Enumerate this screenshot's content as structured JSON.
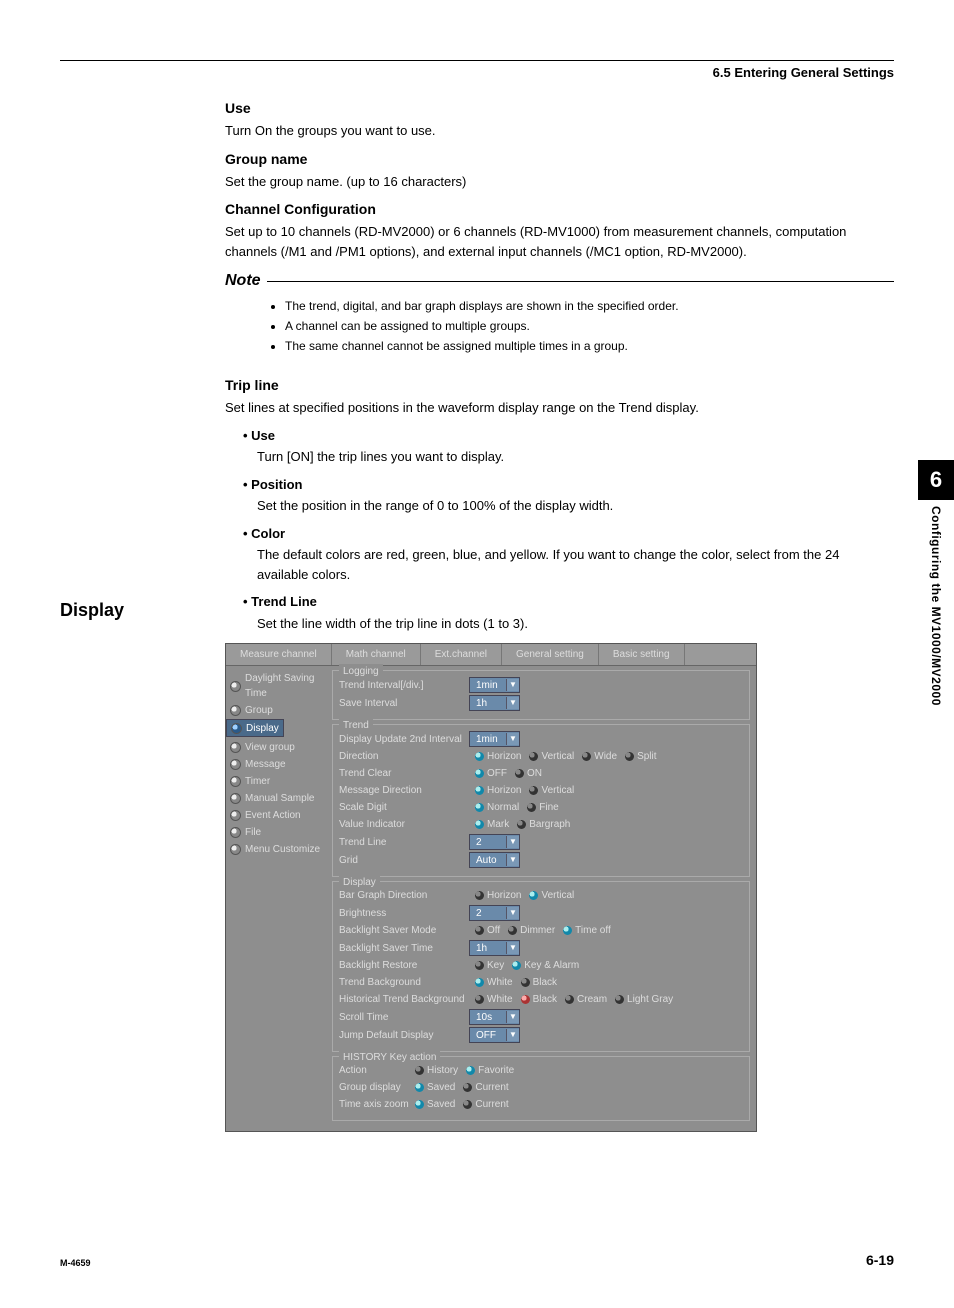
{
  "header": {
    "section": "6.5  Entering General Settings"
  },
  "doc": {
    "use_h": "Use",
    "use_p": "Turn On the groups you want to use.",
    "gn_h": "Group name",
    "gn_p": "Set the group name. (up to 16 characters)",
    "cc_h": "Channel Configuration",
    "cc_p": "Set up to 10 channels (RD-MV2000) or 6 channels (RD-MV1000) from measurement channels, computation channels (/M1 and /PM1 options), and external input channels (/MC1 option, RD-MV2000).",
    "note_label": "Note",
    "note_items": [
      "The trend, digital, and bar graph displays are shown in the specified order.",
      "A channel can be assigned to multiple groups.",
      "The same channel cannot be assigned multiple times in a group."
    ],
    "tl_h": "Trip line",
    "tl_p": "Set lines at specified positions in the waveform display range on the Trend display.",
    "bullets": [
      {
        "h": "Use",
        "t": "Turn [ON] the trip lines you want to display."
      },
      {
        "h": "Position",
        "t": "Set the position in the range of 0 to 100% of the display width."
      },
      {
        "h": "Color",
        "t": "The default colors are red, green, blue, and yellow.  If you want to change the color, select from the 24 available colors."
      },
      {
        "h": "Trend Line",
        "t": "Set the line width of the trip line in dots (1 to 3)."
      }
    ],
    "left_title": "Display"
  },
  "side": {
    "num": "6",
    "text": "Configuring the MV1000/MV2000"
  },
  "app": {
    "tabs": [
      "Measure channel",
      "Math channel",
      "Ext.channel",
      "General setting",
      "Basic setting"
    ],
    "menu": [
      "Daylight Saving Time",
      "Group",
      "Display",
      "View group",
      "Message",
      "Timer",
      "Manual Sample",
      "Event Action",
      "File",
      "Menu Customize"
    ],
    "menu_selected": 2,
    "logging_legend": "Logging",
    "trend_legend": "Trend",
    "display_legend": "Display",
    "history_legend": "HISTORY Key action",
    "rows": {
      "ti": {
        "l": "Trend Interval[/div.]",
        "v": "1min"
      },
      "si": {
        "l": "Save Interval",
        "v": "1h"
      },
      "du": {
        "l": "Display Update 2nd Interval",
        "v": "1min"
      },
      "dir": {
        "l": "Direction",
        "o": [
          "Horizon",
          "Vertical",
          "Wide",
          "Split"
        ]
      },
      "tc": {
        "l": "Trend Clear",
        "o": [
          "OFF",
          "ON"
        ]
      },
      "md": {
        "l": "Message Direction",
        "o": [
          "Horizon",
          "Vertical"
        ]
      },
      "sd": {
        "l": "Scale Digit",
        "o": [
          "Normal",
          "Fine"
        ]
      },
      "vi": {
        "l": "Value Indicator",
        "o": [
          "Mark",
          "Bargraph"
        ]
      },
      "tln": {
        "l": "Trend Line",
        "v": "2"
      },
      "gr": {
        "l": "Grid",
        "v": "Auto"
      },
      "bgd": {
        "l": "Bar Graph Direction",
        "o": [
          "Horizon",
          "Vertical"
        ]
      },
      "br": {
        "l": "Brightness",
        "v": "2"
      },
      "bsm": {
        "l": "Backlight Saver Mode",
        "o": [
          "Off",
          "Dimmer",
          "Time off"
        ]
      },
      "bst": {
        "l": "Backlight Saver Time",
        "v": "1h"
      },
      "brr": {
        "l": "Backlight Restore",
        "o": [
          "Key",
          "Key & Alarm"
        ]
      },
      "tb": {
        "l": "Trend Background",
        "o": [
          "White",
          "Black"
        ]
      },
      "htb": {
        "l": "Historical Trend Background",
        "o": [
          "White",
          "Black",
          "Cream",
          "Light Gray"
        ]
      },
      "st": {
        "l": "Scroll Time",
        "v": "10s"
      },
      "jdd": {
        "l": "Jump Default Display",
        "v": "OFF"
      },
      "ac": {
        "l": "Action",
        "o": [
          "History",
          "Favorite"
        ]
      },
      "gd": {
        "l": "Group display",
        "o": [
          "Saved",
          "Current"
        ]
      },
      "taz": {
        "l": "Time axis zoom",
        "o": [
          "Saved",
          "Current"
        ]
      }
    }
  },
  "footer": {
    "code": "M-4659",
    "page": "6-19"
  }
}
